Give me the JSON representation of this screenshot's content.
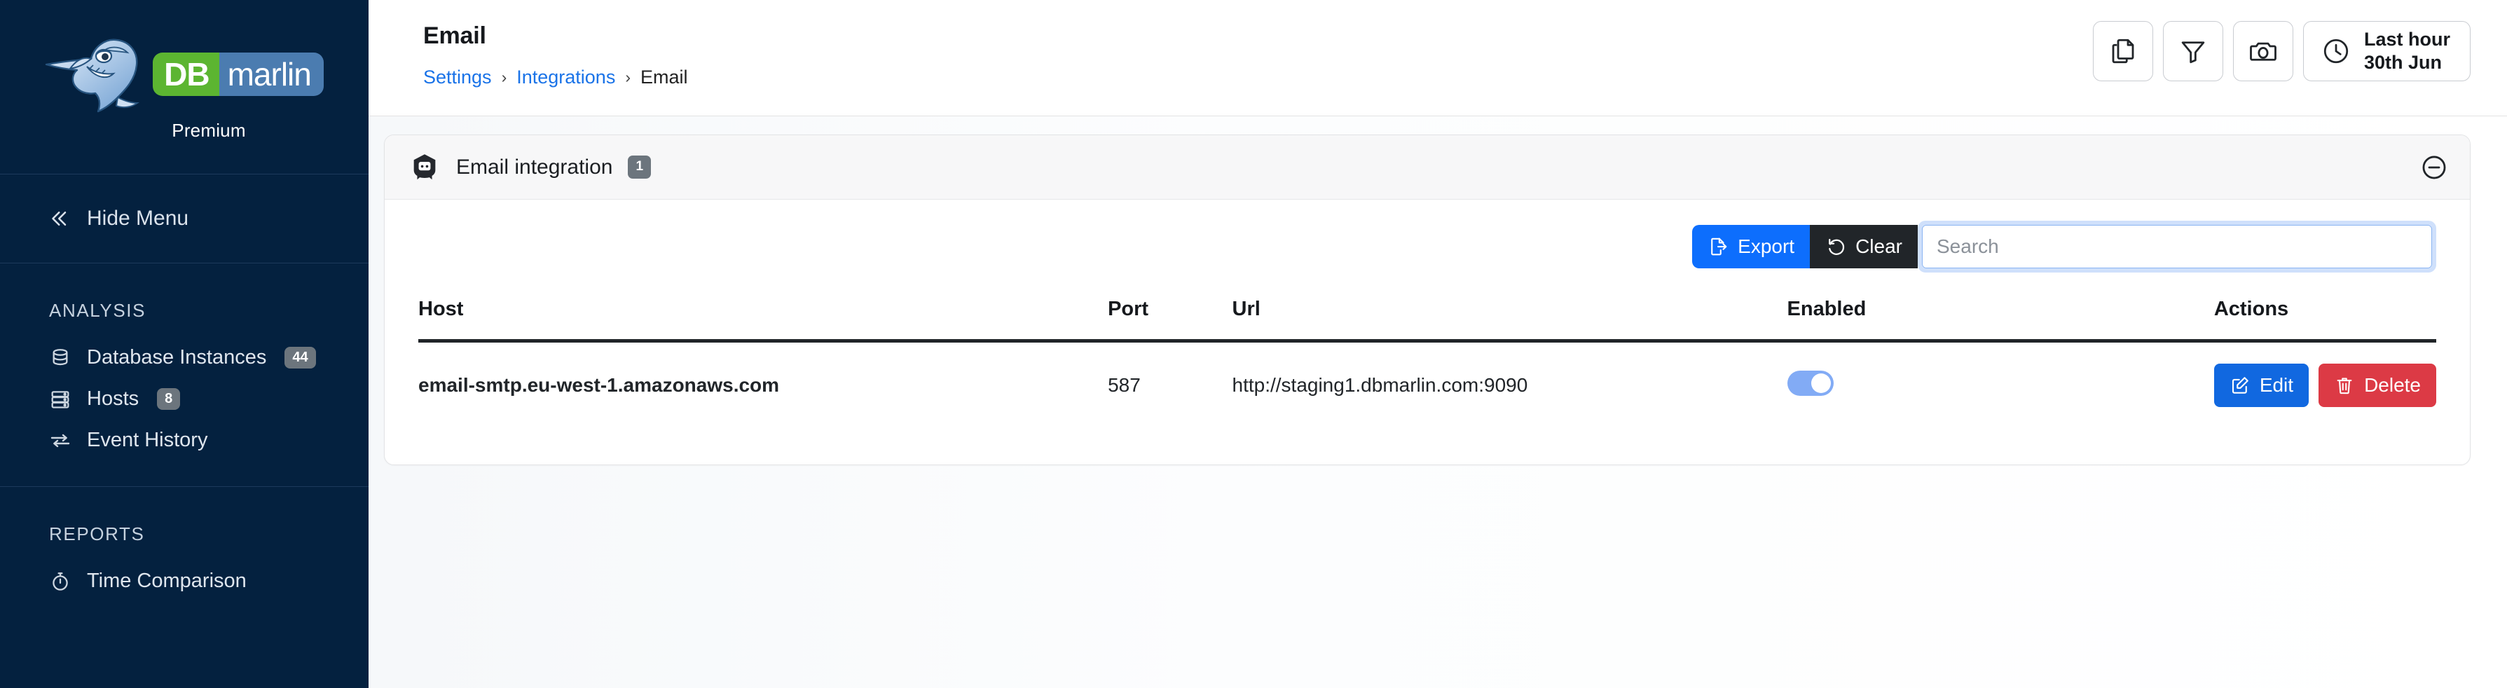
{
  "sidebar": {
    "brand": {
      "db": "DB",
      "marlin": "marlin",
      "tier": "Premium",
      "logo_icon": "marlin-fish-logo"
    },
    "hide_menu": {
      "label": "Hide Menu",
      "icon": "chevron-double-left-icon"
    },
    "sections": [
      {
        "title": "ANALYSIS",
        "items": [
          {
            "label": "Database Instances",
            "badge": "44",
            "icon": "database-icon"
          },
          {
            "label": "Hosts",
            "badge": "8",
            "icon": "server-rack-icon"
          },
          {
            "label": "Event History",
            "badge": "",
            "icon": "exchange-arrows-icon"
          }
        ]
      },
      {
        "title": "REPORTS",
        "items": [
          {
            "label": "Time Comparison",
            "badge": "",
            "icon": "stopwatch-icon"
          }
        ]
      }
    ]
  },
  "topbar": {
    "title": "Email",
    "breadcrumb": {
      "settings": "Settings",
      "integrations": "Integrations",
      "current": "Email",
      "separator": "›"
    },
    "buttons": [
      {
        "name": "copy-button",
        "icon": "copy-pages-icon"
      },
      {
        "name": "filter-button",
        "icon": "funnel-filter-icon"
      },
      {
        "name": "snapshot-button",
        "icon": "camera-icon"
      }
    ],
    "time_range": {
      "icon": "clock-icon",
      "line1": "Last hour",
      "line2": "30th Jun"
    }
  },
  "panel": {
    "icon": "email-envelope-icon",
    "title": "Email integration",
    "count_badge": "1",
    "collapse_icon": "minus-circle-icon",
    "toolbar": {
      "export_label": "Export",
      "export_icon": "export-file-icon",
      "clear_label": "Clear",
      "clear_icon": "undo-arrow-icon",
      "search_placeholder": "Search",
      "search_value": ""
    },
    "table": {
      "columns": [
        "Host",
        "Port",
        "Url",
        "Enabled",
        "Actions"
      ],
      "rows": [
        {
          "host": "email-smtp.eu-west-1.amazonaws.com",
          "port": "587",
          "url": "http://staging1.dbmarlin.com:9090",
          "enabled": true,
          "edit_label": "Edit",
          "edit_icon": "pencil-square-icon",
          "delete_label": "Delete",
          "delete_icon": "trash-icon"
        }
      ]
    }
  },
  "colors": {
    "sidebar_bg": "#04213f",
    "brand_green": "#5cb531",
    "brand_blue": "#4b7cb0",
    "link_blue": "#1a73e8",
    "primary_blue": "#0d6efd",
    "edit_blue": "#1168e0",
    "danger_red": "#dc3a45",
    "dark": "#212529",
    "badge_gray": "#6c757d",
    "toggle_on": "#82abf5"
  }
}
